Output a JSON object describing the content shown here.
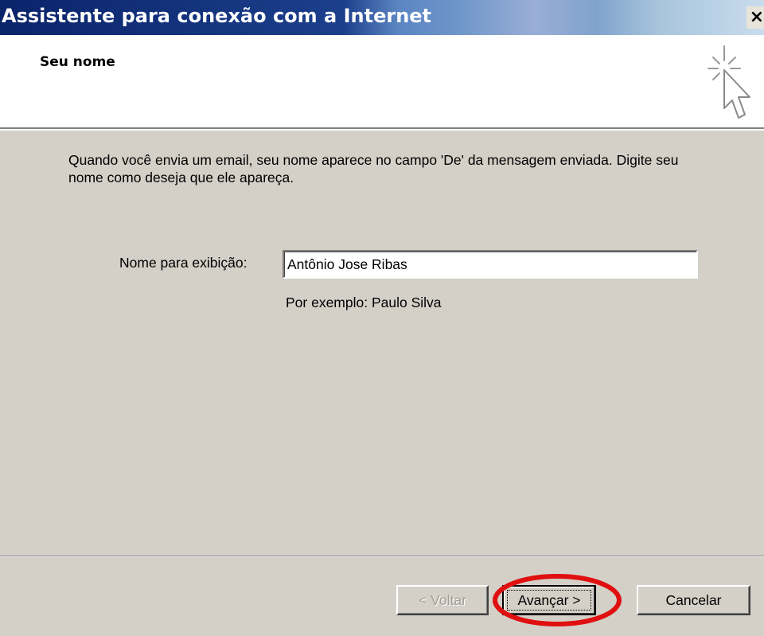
{
  "window": {
    "title": "Assistente para conexão com a Internet",
    "close_label": "×"
  },
  "header": {
    "page_title": "Seu nome",
    "icon": "wizard-cursor-icon"
  },
  "body": {
    "intro_text": "Quando você envia um email, seu nome aparece no campo 'De' da mensagem enviada. Digite seu nome como deseja que ele apareça.",
    "display_name_label": "Nome para exibição:",
    "display_name_value": "Antônio Jose Ribas",
    "example_hint": "Por exemplo: Paulo Silva"
  },
  "footer": {
    "back_label": "< Voltar",
    "next_label": "Avançar >",
    "cancel_label": "Cancelar"
  },
  "annotation": {
    "highlight_color": "#e01010",
    "highlight_target": "next-button"
  },
  "colors": {
    "dialog_bg": "#d4d0c8",
    "title_bar": "#0a246a"
  }
}
